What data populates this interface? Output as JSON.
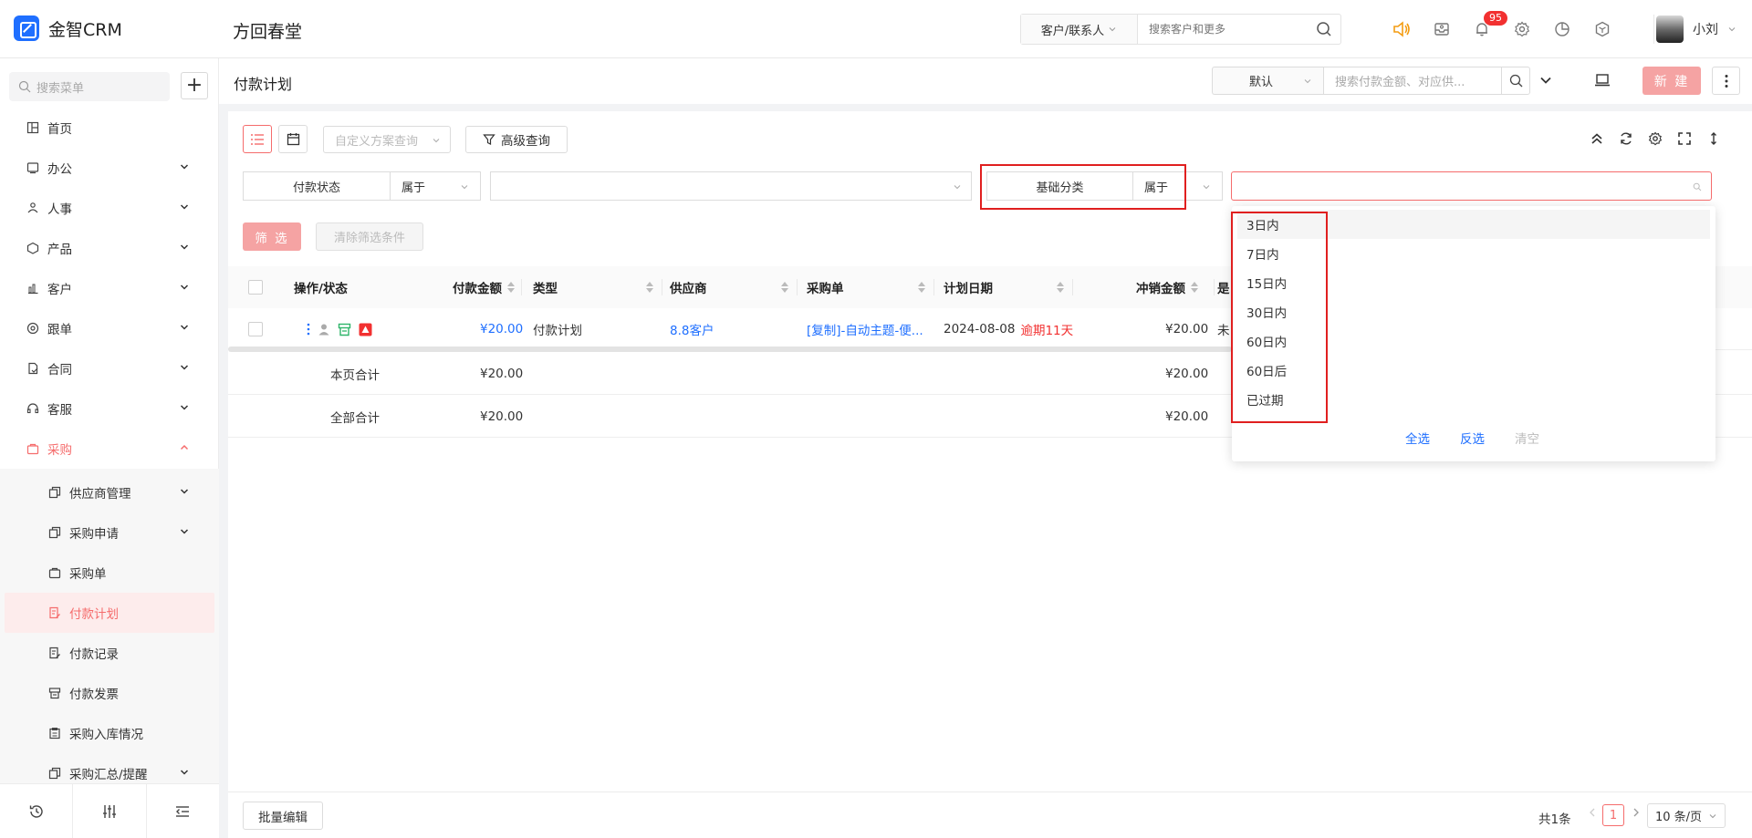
{
  "brand": {
    "name": "金智CRM",
    "org": "方回春堂"
  },
  "global_search": {
    "type": "客户/联系人",
    "placeholder": "搜索客户和更多"
  },
  "notifications": {
    "count": "95"
  },
  "user": {
    "name": "小刘"
  },
  "sidebar": {
    "search_placeholder": "搜索菜单",
    "items": [
      {
        "label": "首页",
        "icon": "home-icon"
      },
      {
        "label": "办公",
        "icon": "office-icon"
      },
      {
        "label": "人事",
        "icon": "hr-icon"
      },
      {
        "label": "产品",
        "icon": "product-icon"
      },
      {
        "label": "客户",
        "icon": "customer-icon"
      },
      {
        "label": "跟单",
        "icon": "follow-icon"
      },
      {
        "label": "合同",
        "icon": "contract-icon"
      },
      {
        "label": "客服",
        "icon": "service-icon"
      },
      {
        "label": "采购",
        "icon": "purchase-icon"
      }
    ],
    "sub_items": [
      {
        "label": "供应商管理"
      },
      {
        "label": "采购申请"
      },
      {
        "label": "采购单"
      },
      {
        "label": "付款计划"
      },
      {
        "label": "付款记录"
      },
      {
        "label": "付款发票"
      },
      {
        "label": "采购入库情况"
      },
      {
        "label": "采购汇总/提醒"
      }
    ]
  },
  "page": {
    "title": "付款计划",
    "view": "默认",
    "search_placeholder": "搜索付款金额、对应供...",
    "new_label": "新 建"
  },
  "toolbar": {
    "scheme_placeholder": "自定义方案查询",
    "advanced_label": "高级查询"
  },
  "filters": [
    {
      "field": "付款状态",
      "op": "属于",
      "value": ""
    },
    {
      "field": "基础分类",
      "op": "属于",
      "value": ""
    }
  ],
  "actions": {
    "filter_label": "筛 选",
    "clear_label": "清除筛选条件"
  },
  "table": {
    "headers": [
      "操作/状态",
      "付款金额",
      "类型",
      "供应商",
      "采购单",
      "计划日期",
      "冲销金额",
      "是"
    ],
    "rows": [
      {
        "amount": "¥20.00",
        "type": "付款计划",
        "supplier": "8.8客户",
        "order": "[复制]-自动主题-便...",
        "date": "2024-08-08",
        "overdue": "逾期11天",
        "writeoff": "¥20.00",
        "extra": "未"
      }
    ],
    "page_total": {
      "label": "本页合计",
      "amount": "¥20.00",
      "writeoff": "¥20.00"
    },
    "all_total": {
      "label": "全部合计",
      "amount": "¥20.00",
      "writeoff": "¥20.00"
    }
  },
  "dropdown": {
    "options": [
      "3日内",
      "7日内",
      "15日内",
      "30日内",
      "60日内",
      "60日后",
      "已过期"
    ],
    "select_all": "全选",
    "invert": "反选",
    "clear": "清空"
  },
  "footer": {
    "batch_label": "批量编辑",
    "total": "共1条",
    "current_page": "1",
    "page_size": "10 条/页"
  },
  "colors": {
    "accent": "#f56c6c",
    "link": "#1f6fff",
    "danger": "#f23030",
    "highlight": "#e01f1f"
  }
}
